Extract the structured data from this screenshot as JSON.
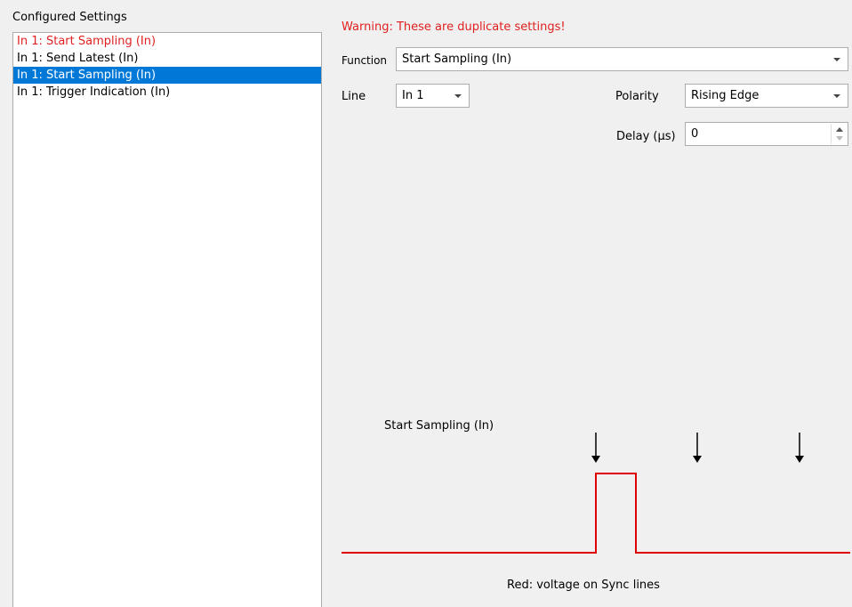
{
  "left_panel": {
    "title": "Configured Settings",
    "items": [
      {
        "label": "In 1: Start Sampling (In)",
        "state": "warning"
      },
      {
        "label": "In 1: Send Latest (In)",
        "state": "normal"
      },
      {
        "label": "In 1: Start Sampling (In)",
        "state": "selected"
      },
      {
        "label": "In 1: Trigger Indication (In)",
        "state": "normal"
      }
    ]
  },
  "form": {
    "warning": "Warning: These are duplicate settings!",
    "function_label": "Function",
    "function_value": "Start Sampling (In)",
    "line_label": "Line",
    "line_value": "In 1",
    "polarity_label": "Polarity",
    "polarity_value": "Rising Edge",
    "delay_label": "Delay (µs)",
    "delay_value": "0"
  },
  "diagram": {
    "signal_label": "Start Sampling (In)",
    "legend": "Red: voltage on Sync lines",
    "signal_color": "#e00000",
    "arrow_color": "#000000"
  },
  "colors": {
    "warning": "#e02020",
    "selection": "#0078d7"
  }
}
